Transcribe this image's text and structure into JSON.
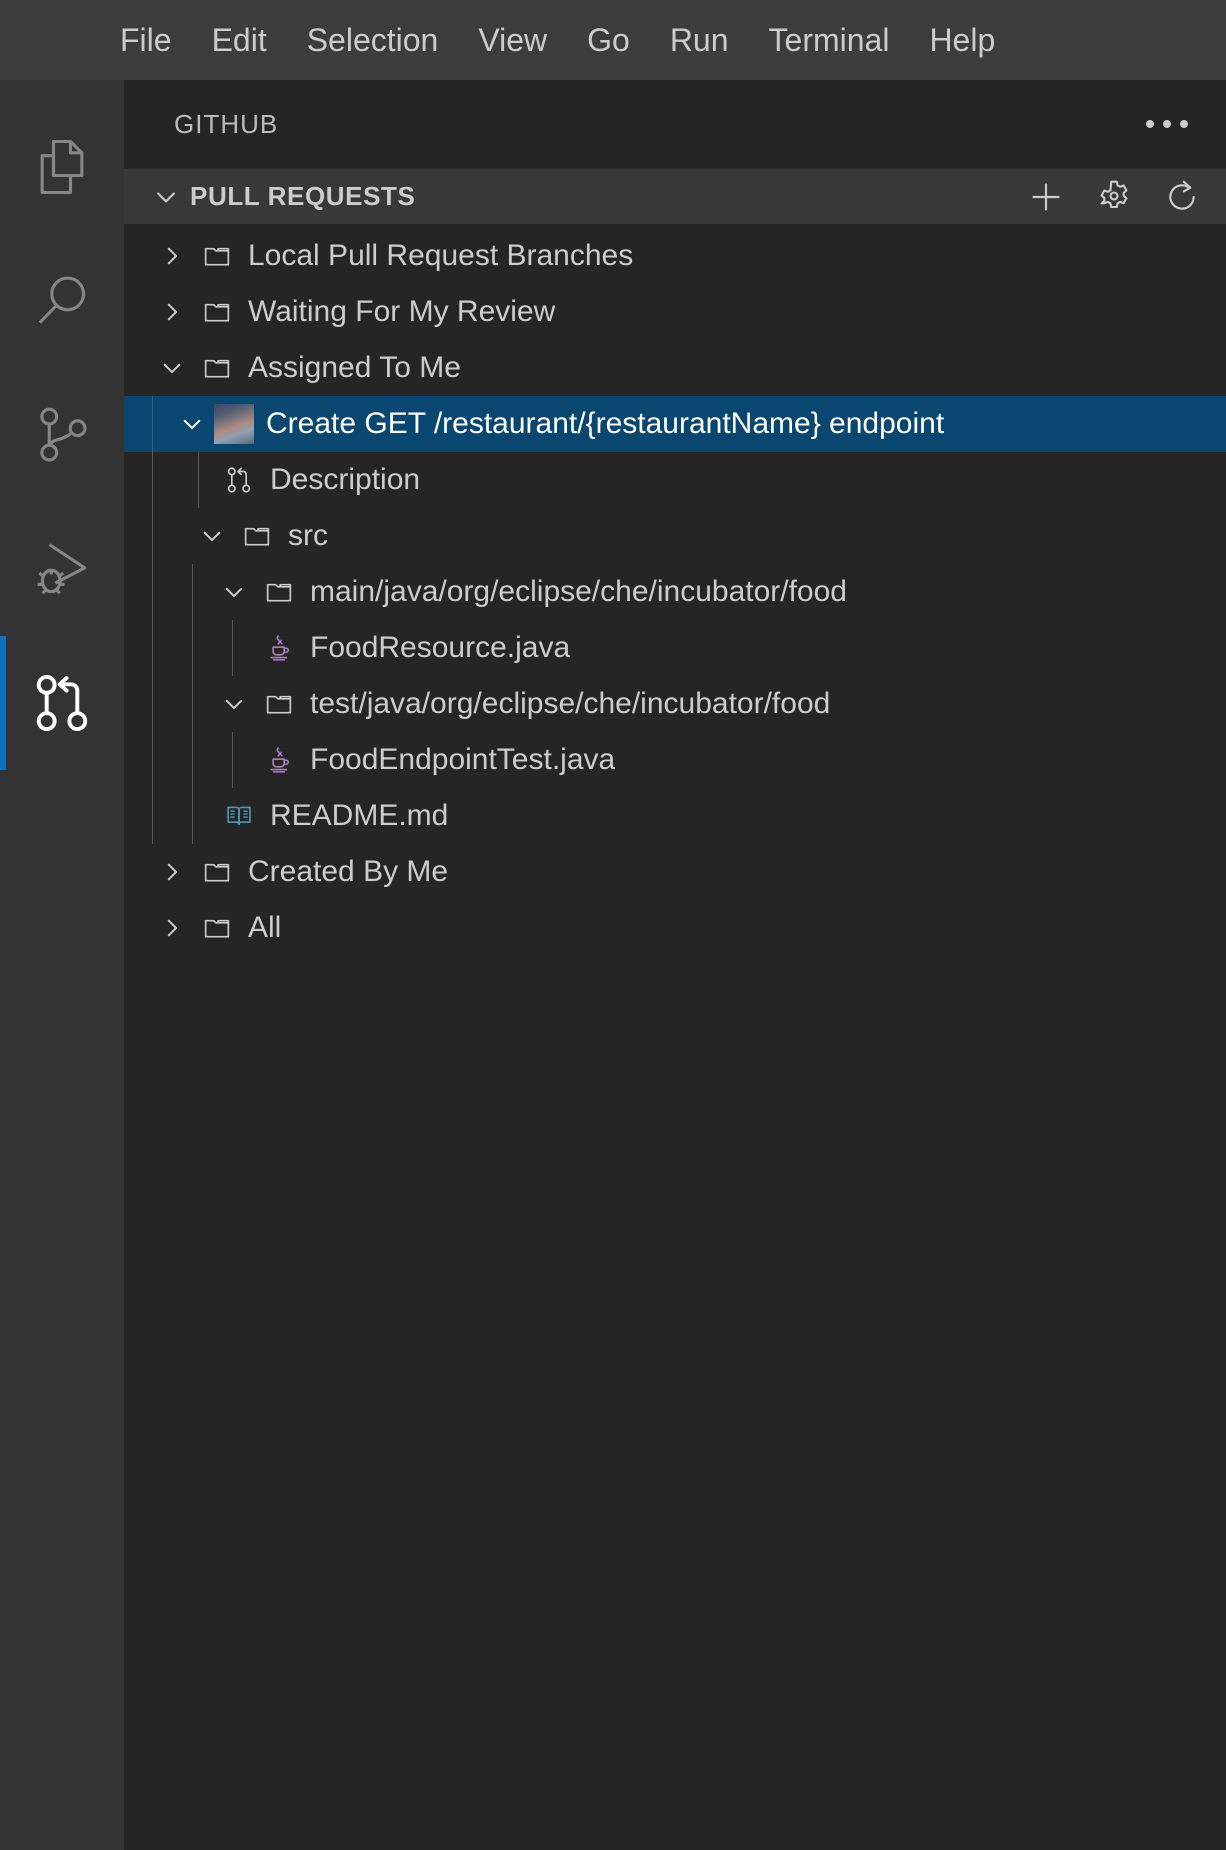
{
  "menubar": {
    "items": [
      {
        "label": "File"
      },
      {
        "label": "Edit"
      },
      {
        "label": "Selection"
      },
      {
        "label": "View"
      },
      {
        "label": "Go"
      },
      {
        "label": "Run"
      },
      {
        "label": "Terminal"
      },
      {
        "label": "Help"
      }
    ]
  },
  "activitybar": {
    "items": [
      {
        "name": "explorer",
        "icon": "files-icon",
        "active": false
      },
      {
        "name": "search",
        "icon": "search-icon",
        "active": false
      },
      {
        "name": "source-control",
        "icon": "source-control-icon",
        "active": false
      },
      {
        "name": "run-and-debug",
        "icon": "run-and-debug-icon",
        "active": false
      },
      {
        "name": "github-pull-requests",
        "icon": "git-pull-request-icon",
        "active": true
      }
    ],
    "active_indicator_color": "#0e70c0"
  },
  "sidebar": {
    "title": "GITHUB",
    "more_actions_label": "...",
    "section": {
      "label": "PULL REQUESTS",
      "expanded": true,
      "actions": [
        {
          "name": "create-pull-request",
          "icon": "plus-icon"
        },
        {
          "name": "configure-remotes",
          "icon": "gear-icon"
        },
        {
          "name": "refresh",
          "icon": "refresh-icon"
        }
      ]
    },
    "tree": [
      {
        "label": "Local Pull Request Branches",
        "icon": "folder-icon",
        "indent": 0,
        "state": "collapsed"
      },
      {
        "label": "Waiting For My Review",
        "icon": "folder-icon",
        "indent": 0,
        "state": "collapsed"
      },
      {
        "label": "Assigned To Me",
        "icon": "folder-icon",
        "indent": 0,
        "state": "expanded"
      },
      {
        "label": "Create GET /restaurant/{restaurantName} endpoint",
        "icon": "avatar",
        "indent": 1,
        "state": "expanded",
        "selected": true
      },
      {
        "label": "Description",
        "icon": "git-pull-request-icon",
        "indent": 2,
        "state": "leaf"
      },
      {
        "label": "src",
        "icon": "folder-icon",
        "indent": 2,
        "state": "expanded"
      },
      {
        "label": "main/java/org/eclipse/che/incubator/food",
        "icon": "folder-icon",
        "indent": 3,
        "state": "expanded"
      },
      {
        "label": "FoodResource.java",
        "icon": "java-icon",
        "indent": 4,
        "state": "leaf"
      },
      {
        "label": "test/java/org/eclipse/che/incubator/food",
        "icon": "folder-icon",
        "indent": 3,
        "state": "expanded"
      },
      {
        "label": "FoodEndpointTest.java",
        "icon": "java-icon",
        "indent": 4,
        "state": "leaf"
      },
      {
        "label": "README.md",
        "icon": "markdown-icon",
        "indent": 3,
        "state": "leaf"
      },
      {
        "label": "Created By Me",
        "icon": "folder-icon",
        "indent": 0,
        "state": "collapsed"
      },
      {
        "label": "All",
        "icon": "folder-icon",
        "indent": 0,
        "state": "collapsed"
      }
    ]
  },
  "colors": {
    "selection_background": "#094771",
    "activitybar_background": "#333333",
    "sidebar_background": "#252526",
    "section_header_background": "#383838",
    "menubar_background": "#3c3c3c",
    "java_icon": "#b07cc6",
    "markdown_icon": "#519aba",
    "foreground": "#cccccc"
  }
}
